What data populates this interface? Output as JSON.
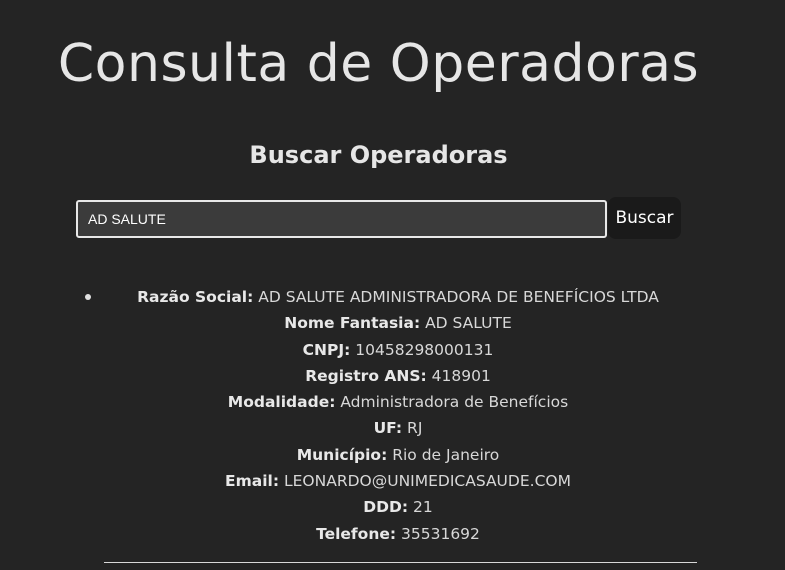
{
  "header": {
    "title": "Consulta de Operadoras"
  },
  "search": {
    "heading": "Buscar Operadoras",
    "value": "AD SALUTE",
    "button_label": "Buscar"
  },
  "results": [
    {
      "fields": [
        {
          "label": "Razão Social:",
          "value": " AD SALUTE ADMINISTRADORA DE BENEFÍCIOS LTDA"
        },
        {
          "label": "Nome Fantasia:",
          "value": " AD SALUTE"
        },
        {
          "label": "CNPJ:",
          "value": " 10458298000131"
        },
        {
          "label": "Registro ANS:",
          "value": " 418901"
        },
        {
          "label": "Modalidade:",
          "value": " Administradora de Benefícios"
        },
        {
          "label": "UF:",
          "value": " RJ"
        },
        {
          "label": "Município:",
          "value": " Rio de Janeiro"
        },
        {
          "label": "Email:",
          "value": " LEONARDO@UNIMEDICASAUDE.COM"
        },
        {
          "label": "DDD:",
          "value": " 21"
        },
        {
          "label": "Telefone:",
          "value": " 35531692"
        }
      ]
    }
  ]
}
